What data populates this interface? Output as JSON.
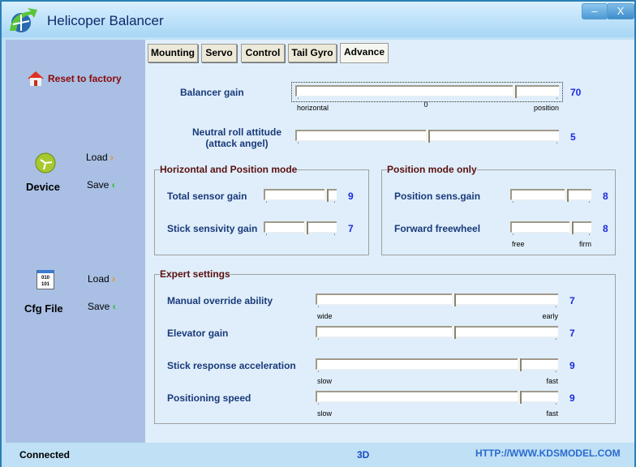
{
  "window": {
    "title": "Helicoper Balancer",
    "minimize": "–",
    "close": "X"
  },
  "sidebar": {
    "reset": "Reset to factory",
    "device": {
      "label": "Device",
      "load": "Load",
      "save": "Save"
    },
    "cfg": {
      "label": "Cfg File",
      "load": "Load",
      "save": "Save"
    },
    "cfg_icon_text": "010 101"
  },
  "tabs": [
    {
      "label": "Mounting"
    },
    {
      "label": "Servo"
    },
    {
      "label": "Control"
    },
    {
      "label": "Tail Gyro"
    },
    {
      "label": "Advance",
      "active": true
    }
  ],
  "sliders": {
    "balancer": {
      "label": "Balancer gain",
      "value": "70",
      "fraction": 0.84,
      "left": "horizontal",
      "mid": "0",
      "right": "position"
    },
    "neutral": {
      "label1": "Neutral roll attitude",
      "label2": "(attack angel)",
      "value": "5",
      "fraction": 0.5
    },
    "total": {
      "label": "Total sensor gain",
      "value": "9",
      "fraction": 0.89
    },
    "stick": {
      "label": "Stick sensivity gain",
      "value": "7",
      "fraction": 0.58
    },
    "possens": {
      "label": "Position sens.gain",
      "value": "8",
      "fraction": 0.71
    },
    "forward": {
      "label": "Forward freewheel",
      "value": "8",
      "fraction": 0.77,
      "left": "free",
      "right": "firm"
    },
    "manual": {
      "label": "Manual override ability",
      "value": "7",
      "fraction": 0.57,
      "left": "wide",
      "right": "early"
    },
    "elevator": {
      "label": "Elevator gain",
      "value": "7",
      "fraction": 0.57
    },
    "response": {
      "label": "Stick response acceleration",
      "value": "9",
      "fraction": 0.85,
      "left": "slow",
      "right": "fast"
    },
    "positioning": {
      "label": "Positioning speed",
      "value": "9",
      "fraction": 0.85,
      "left": "slow",
      "right": "fast"
    }
  },
  "groups": {
    "hp": "Horizontal and Position mode",
    "pos": "Position mode only",
    "expert": "Expert settings"
  },
  "status": {
    "left": "Connected",
    "mid": "3D",
    "right": "HTTP://WWW.KDSMODEL.COM"
  }
}
